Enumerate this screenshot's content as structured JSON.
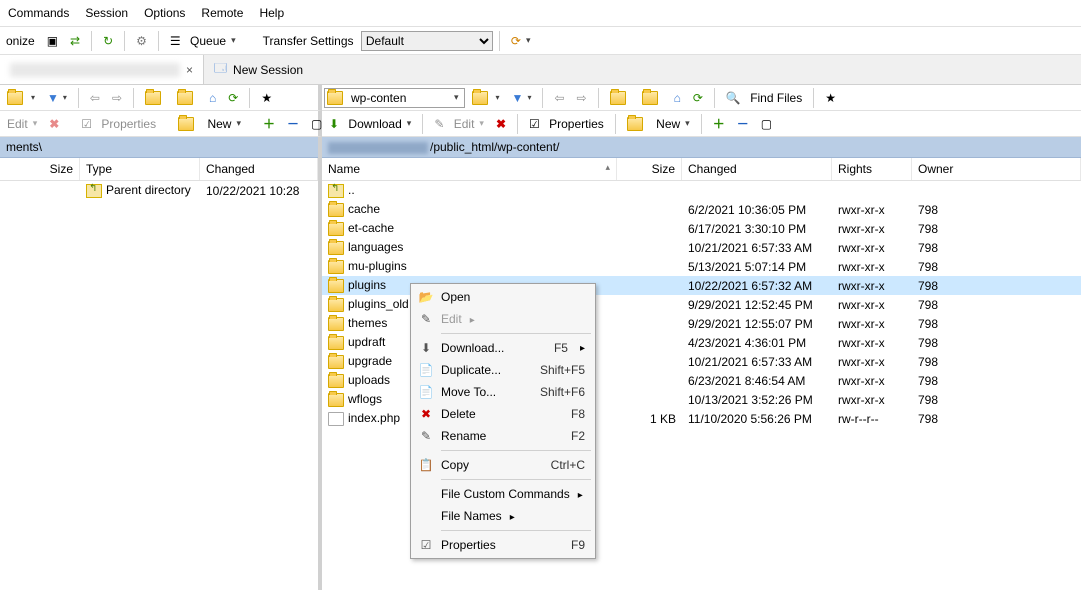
{
  "menu": {
    "items": [
      "Commands",
      "Session",
      "Options",
      "Remote",
      "Help"
    ]
  },
  "toolbar1": {
    "sync_label": "onize",
    "queue_label": "Queue",
    "transfer_label": "Transfer Settings",
    "transfer_value": "Default"
  },
  "tabs": {
    "close": "×",
    "new_session": "New Session"
  },
  "left": {
    "path_label": "ments\\",
    "find_label": "",
    "edit": "Edit",
    "properties": "Properties",
    "new": "New",
    "cols": {
      "size": "Size",
      "type": "Type",
      "changed": "Changed"
    },
    "rows": [
      {
        "type": "Parent directory",
        "changed": "10/22/2021  10:28"
      }
    ]
  },
  "right": {
    "combo_value": "wp-conten",
    "find_label": "Find Files",
    "download": "Download",
    "edit": "Edit",
    "properties": "Properties",
    "new": "New",
    "path": "/public_html/wp-content/",
    "cols": {
      "name": "Name",
      "size": "Size",
      "changed": "Changed",
      "rights": "Rights",
      "owner": "Owner"
    },
    "rows": [
      {
        "ic": "up",
        "name": ".."
      },
      {
        "ic": "folder",
        "name": "cache",
        "changed": "6/2/2021 10:36:05 PM",
        "rights": "rwxr-xr-x",
        "owner": "798"
      },
      {
        "ic": "folder",
        "name": "et-cache",
        "changed": "6/17/2021 3:30:10 PM",
        "rights": "rwxr-xr-x",
        "owner": "798"
      },
      {
        "ic": "folder",
        "name": "languages",
        "changed": "10/21/2021 6:57:33 AM",
        "rights": "rwxr-xr-x",
        "owner": "798"
      },
      {
        "ic": "folder",
        "name": "mu-plugins",
        "changed": "5/13/2021 5:07:14 PM",
        "rights": "rwxr-xr-x",
        "owner": "798"
      },
      {
        "ic": "folder",
        "name": "plugins",
        "changed": "10/22/2021 6:57:32 AM",
        "rights": "rwxr-xr-x",
        "owner": "798",
        "selected": true
      },
      {
        "ic": "folder",
        "name": "plugins_old",
        "changed": "9/29/2021 12:52:45 PM",
        "rights": "rwxr-xr-x",
        "owner": "798"
      },
      {
        "ic": "folder",
        "name": "themes",
        "changed": "9/29/2021 12:55:07 PM",
        "rights": "rwxr-xr-x",
        "owner": "798"
      },
      {
        "ic": "folder",
        "name": "updraft",
        "changed": "4/23/2021 4:36:01 PM",
        "rights": "rwxr-xr-x",
        "owner": "798"
      },
      {
        "ic": "folder",
        "name": "upgrade",
        "changed": "10/21/2021 6:57:33 AM",
        "rights": "rwxr-xr-x",
        "owner": "798"
      },
      {
        "ic": "folder",
        "name": "uploads",
        "changed": "6/23/2021 8:46:54 AM",
        "rights": "rwxr-xr-x",
        "owner": "798"
      },
      {
        "ic": "folder",
        "name": "wflogs",
        "changed": "10/13/2021 3:52:26 PM",
        "rights": "rwxr-xr-x",
        "owner": "798"
      },
      {
        "ic": "file",
        "name": "index.php",
        "size": "1 KB",
        "changed": "11/10/2020 5:56:26 PM",
        "rights": "rw-r--r--",
        "owner": "798"
      }
    ]
  },
  "context_menu": {
    "items": [
      {
        "label": "Open",
        "icon": "📂"
      },
      {
        "label": "Edit",
        "disabled": true,
        "sub": true,
        "icon": "✎"
      },
      {
        "sep": true
      },
      {
        "label": "Download...",
        "shortcut": "F5",
        "sub": true,
        "icon": "⬇"
      },
      {
        "label": "Duplicate...",
        "shortcut": "Shift+F5",
        "icon": "📄"
      },
      {
        "label": "Move To...",
        "shortcut": "Shift+F6",
        "icon": "📄"
      },
      {
        "label": "Delete",
        "shortcut": "F8",
        "icon": "✖",
        "iconColor": "#c00"
      },
      {
        "label": "Rename",
        "shortcut": "F2",
        "icon": "✎"
      },
      {
        "sep": true
      },
      {
        "label": "Copy",
        "shortcut": "Ctrl+C",
        "icon": "📋"
      },
      {
        "sep": true
      },
      {
        "label": "File Custom Commands",
        "sub": true
      },
      {
        "label": "File Names",
        "sub": true
      },
      {
        "sep": true
      },
      {
        "label": "Properties",
        "shortcut": "F9",
        "icon": "☑"
      }
    ]
  }
}
